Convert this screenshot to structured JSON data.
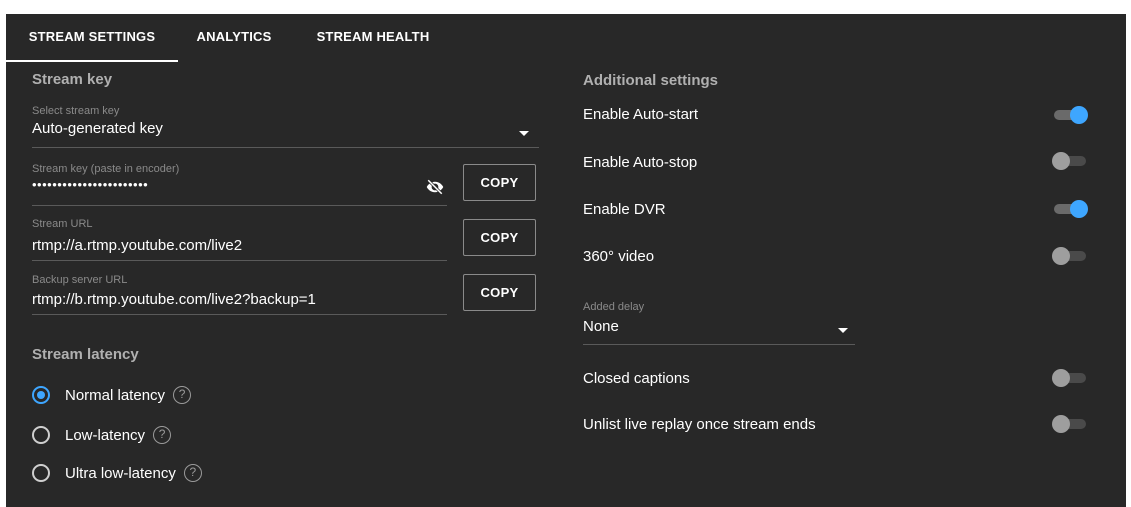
{
  "tabs": [
    {
      "label": "STREAM SETTINGS",
      "active": true
    },
    {
      "label": "ANALYTICS",
      "active": false
    },
    {
      "label": "STREAM HEALTH",
      "active": false
    }
  ],
  "stream_key": {
    "title": "Stream key",
    "select": {
      "label": "Select stream key",
      "value": "Auto-generated key"
    },
    "key_field": {
      "label": "Stream key (paste in encoder)",
      "value": "•••••••••••••••••••••••",
      "copy_label": "COPY",
      "visibility_icon": "eye-off-icon"
    },
    "url_field": {
      "label": "Stream URL",
      "value": "rtmp://a.rtmp.youtube.com/live2",
      "copy_label": "COPY"
    },
    "backup_field": {
      "label": "Backup server URL",
      "value": "rtmp://b.rtmp.youtube.com/live2?backup=1",
      "copy_label": "COPY"
    }
  },
  "latency": {
    "title": "Stream latency",
    "options": [
      {
        "label": "Normal latency",
        "selected": true,
        "help": "?"
      },
      {
        "label": "Low-latency",
        "selected": false,
        "help": "?"
      },
      {
        "label": "Ultra low-latency",
        "selected": false,
        "help": "?"
      }
    ]
  },
  "additional": {
    "title": "Additional settings",
    "settings": [
      {
        "label": "Enable Auto-start",
        "on": true
      },
      {
        "label": "Enable Auto-stop",
        "on": false
      },
      {
        "label": "Enable DVR",
        "on": true
      },
      {
        "label": "360° video",
        "on": false
      }
    ],
    "added_delay": {
      "label": "Added delay",
      "value": "None"
    },
    "settings_bottom": [
      {
        "label": "Closed captions",
        "on": false
      },
      {
        "label": "Unlist live replay once stream ends",
        "on": false
      }
    ]
  },
  "colors": {
    "panel_bg": "#282828",
    "accent": "#3ea6ff",
    "muted_text": "#8a8a8a"
  }
}
